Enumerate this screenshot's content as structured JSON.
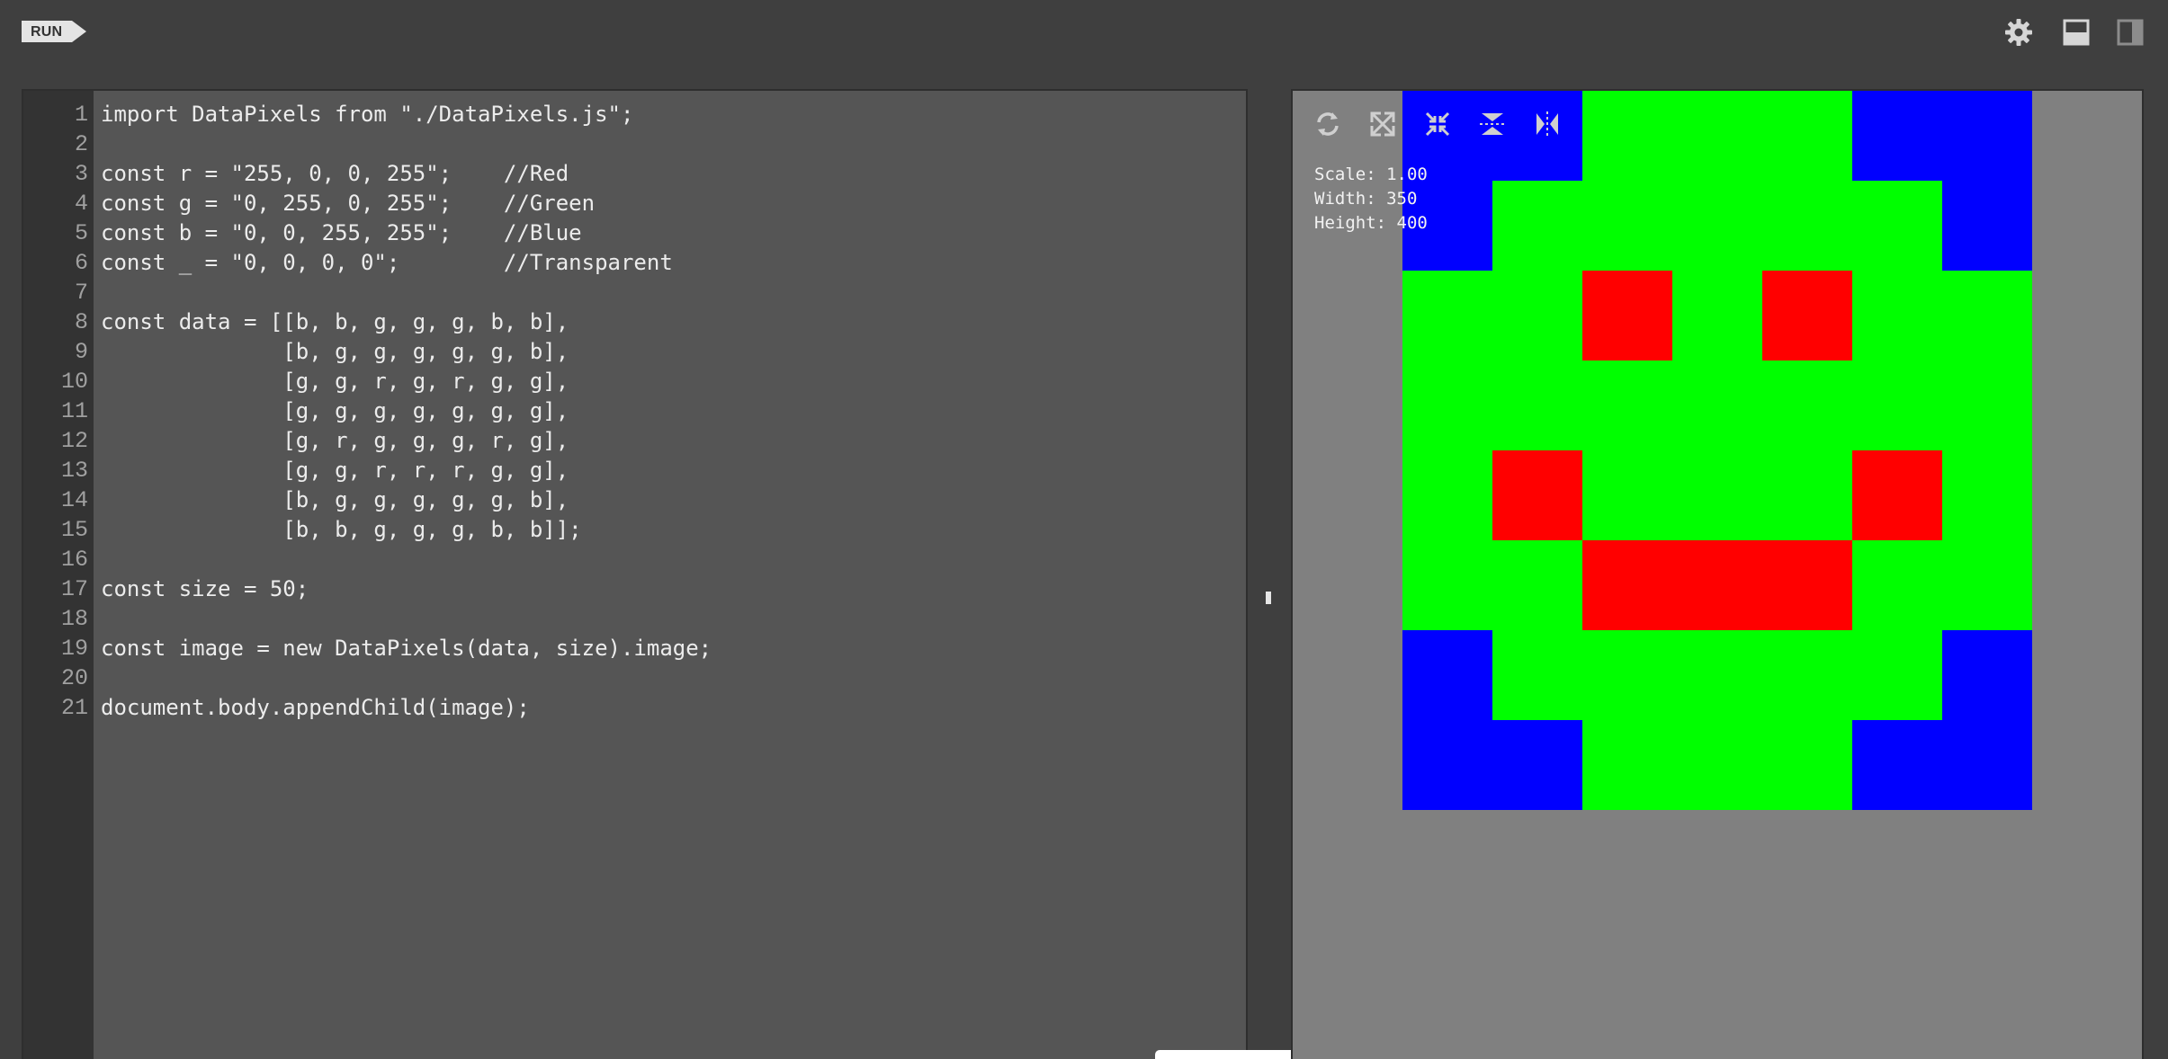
{
  "toolbar": {
    "run_label": "RUN",
    "icons": [
      "gear-icon",
      "layout-bottom-icon",
      "layout-side-icon"
    ]
  },
  "editor": {
    "line_numbers": [
      "1",
      "2",
      "3",
      "4",
      "5",
      "6",
      "7",
      "8",
      "9",
      "10",
      "11",
      "12",
      "13",
      "14",
      "15",
      "16",
      "17",
      "18",
      "19",
      "20",
      "21"
    ],
    "lines": [
      "import DataPixels from \"./DataPixels.js\";",
      "",
      "const r = \"255, 0, 0, 255\";    //Red",
      "const g = \"0, 255, 0, 255\";    //Green",
      "const b = \"0, 0, 255, 255\";    //Blue",
      "const _ = \"0, 0, 0, 0\";        //Transparent",
      "",
      "const data = [[b, b, g, g, g, b, b],",
      "              [b, g, g, g, g, g, b],",
      "              [g, g, r, g, r, g, g],",
      "              [g, g, g, g, g, g, g],",
      "              [g, r, g, g, g, r, g],",
      "              [g, g, r, r, r, g, g],",
      "              [b, g, g, g, g, g, b],",
      "              [b, b, g, g, g, b, b]];",
      "",
      "const size = 50;",
      "",
      "const image = new DataPixels(data, size).image;",
      "",
      "document.body.appendChild(image);"
    ]
  },
  "preview": {
    "tools": [
      "refresh-icon",
      "expand-icon",
      "compress-icon",
      "flip-vertical-icon",
      "flip-horizontal-icon"
    ],
    "stats": {
      "scale": "Scale: 1.00",
      "width": "Width: 350",
      "height": "Height: 400"
    },
    "colors": {
      "r": "#ff0000",
      "g": "#00ff00",
      "b": "#0000ff"
    },
    "pixels": [
      [
        "b",
        "b",
        "g",
        "g",
        "g",
        "b",
        "b"
      ],
      [
        "b",
        "g",
        "g",
        "g",
        "g",
        "g",
        "b"
      ],
      [
        "g",
        "g",
        "r",
        "g",
        "r",
        "g",
        "g"
      ],
      [
        "g",
        "g",
        "g",
        "g",
        "g",
        "g",
        "g"
      ],
      [
        "g",
        "r",
        "g",
        "g",
        "g",
        "r",
        "g"
      ],
      [
        "g",
        "g",
        "r",
        "r",
        "r",
        "g",
        "g"
      ],
      [
        "b",
        "g",
        "g",
        "g",
        "g",
        "g",
        "b"
      ],
      [
        "b",
        "b",
        "g",
        "g",
        "g",
        "b",
        "b"
      ]
    ]
  }
}
